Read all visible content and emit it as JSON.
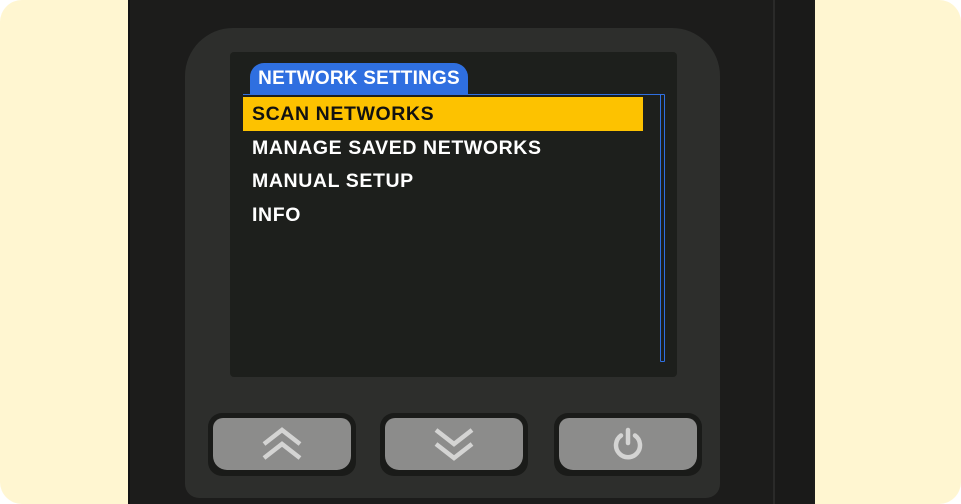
{
  "screen": {
    "title": "NETWORK SETTINGS",
    "menu": [
      {
        "label": "SCAN NETWORKS",
        "selected": true
      },
      {
        "label": "MANAGE SAVED NETWORKS",
        "selected": false
      },
      {
        "label": "MANUAL SETUP",
        "selected": false
      },
      {
        "label": "INFO",
        "selected": false
      }
    ]
  },
  "buttons": {
    "up": {
      "icon": "double-chevron-up-icon"
    },
    "down": {
      "icon": "double-chevron-down-icon"
    },
    "power": {
      "icon": "power-icon"
    }
  },
  "colors": {
    "background": "#fff6d1",
    "device_body": "#1c1c1b",
    "bezel": "#2d2e2c",
    "screen": "#1d1f1c",
    "title_tab": "#2f6fe0",
    "selection_highlight": "#fdc200",
    "button_face": "#8c8c8b"
  }
}
